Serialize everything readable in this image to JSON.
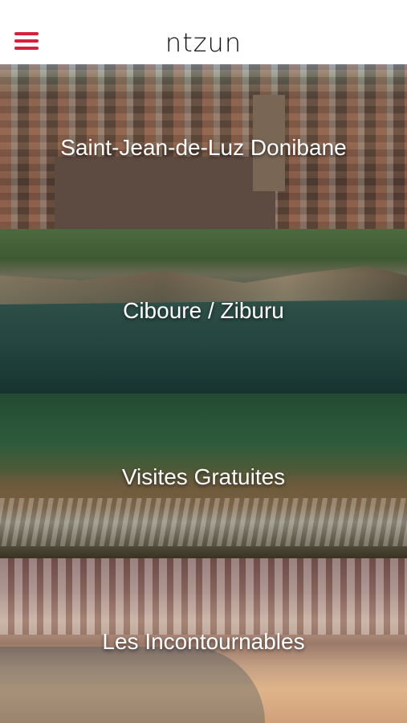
{
  "header": {
    "logo_text": "ntzun"
  },
  "panels": [
    {
      "label": "Saint-Jean-de-Luz   Donibane"
    },
    {
      "label": "Ciboure / Ziburu"
    },
    {
      "label": "Visites Gratuites"
    },
    {
      "label": "Les Incontournables"
    }
  ],
  "colors": {
    "accent": "#d6213e",
    "header_bg": "#ffffff"
  },
  "icons": {
    "menu": "hamburger-menu-icon"
  }
}
